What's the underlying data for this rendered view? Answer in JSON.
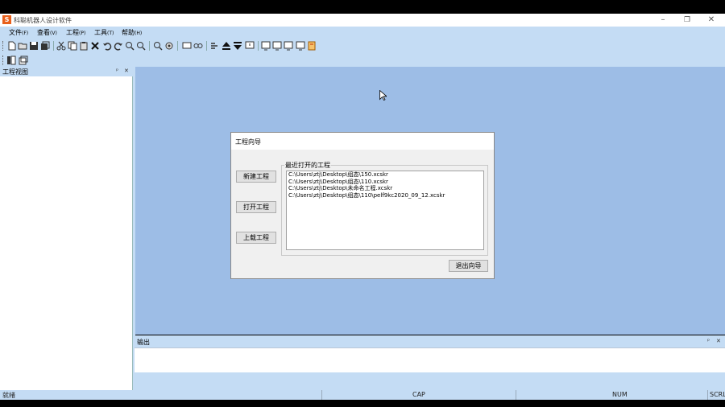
{
  "window": {
    "title": "科聪机器人设计软件",
    "icon_glyph": "S",
    "icon_color": "#e8601c"
  },
  "menu": [
    {
      "label": "文件",
      "accel": "(F)"
    },
    {
      "label": "查看",
      "accel": "(V)"
    },
    {
      "label": "工程",
      "accel": "(P)"
    },
    {
      "label": "工具",
      "accel": "(T)"
    },
    {
      "label": "帮助",
      "accel": "(H)"
    }
  ],
  "project_view": {
    "title": "工程视图"
  },
  "output_panel": {
    "title": "输出"
  },
  "status_bar": {
    "ready": "就绪",
    "cap": "CAP",
    "num": "NUM",
    "scrl": "SCRL"
  },
  "wizard": {
    "title": "工程向导",
    "new_project": "新建工程",
    "open_project": "打开工程",
    "upload_project": "上载工程",
    "recent_group": "最近打开的工程",
    "recent_projects": [
      "C:\\Users\\ztj\\Desktop\\组态\\150.xcskr",
      "C:\\Users\\ztj\\Desktop\\组态\\110.xcskr",
      "C:\\Users\\ztj\\Desktop\\未命名工程.xcskr",
      "C:\\Users\\ztj\\Desktop\\组态\\110\\pelf9kc2020_09_12.xcskr"
    ],
    "exit": "退出向导"
  },
  "colors": {
    "chrome": "#c4dcf4",
    "workspace": "#9dbde6",
    "dialog": "#f0f0f0"
  }
}
